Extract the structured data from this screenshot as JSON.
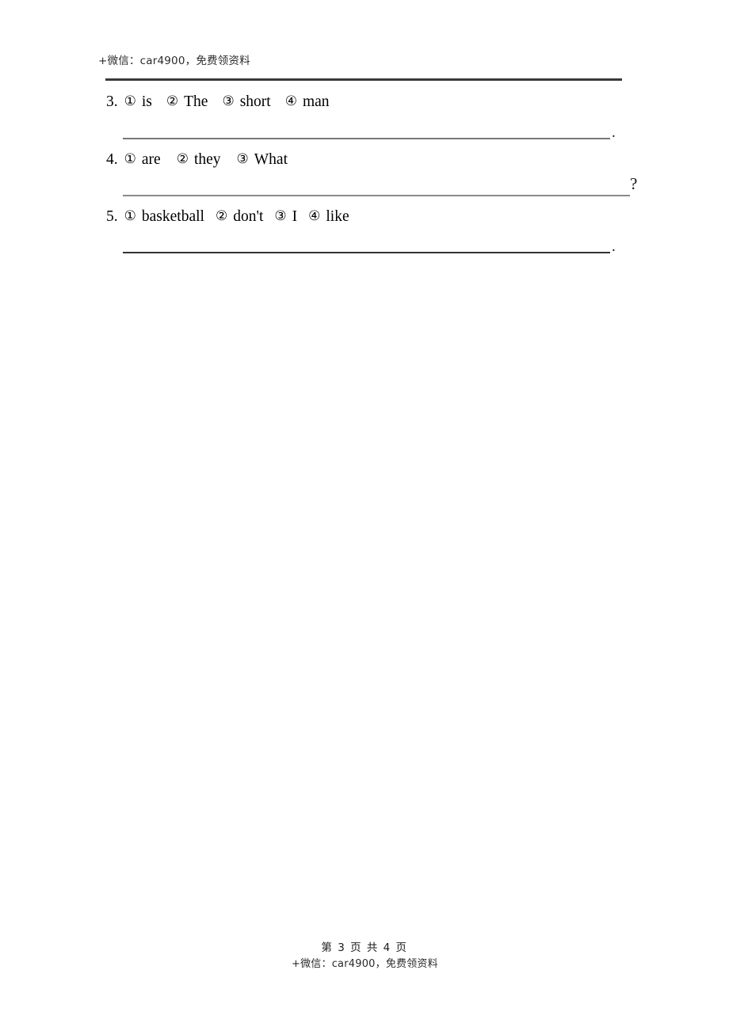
{
  "document": {
    "watermark_top": "+微信：car4900，免费领资料",
    "watermark_bottom": "+微信：car4900，免费领资料",
    "footer_page_label": "第 3 页 共 4 页"
  },
  "questions": [
    {
      "number": "3.",
      "options": [
        {
          "mark": "①",
          "word": "is"
        },
        {
          "mark": "②",
          "word": "The"
        },
        {
          "mark": "③",
          "word": "short"
        },
        {
          "mark": "④",
          "word": "man"
        }
      ],
      "answer_value": "",
      "end_punctuation": "."
    },
    {
      "number": "4.",
      "options": [
        {
          "mark": "①",
          "word": "are"
        },
        {
          "mark": "②",
          "word": "they"
        },
        {
          "mark": "③",
          "word": "What"
        }
      ],
      "answer_value": "",
      "end_punctuation": "?"
    },
    {
      "number": "5.",
      "options": [
        {
          "mark": "①",
          "word": "basketball"
        },
        {
          "mark": "②",
          "word": "don't"
        },
        {
          "mark": "③",
          "word": "I"
        },
        {
          "mark": "④",
          "word": "like"
        }
      ],
      "answer_value": "",
      "end_punctuation": "."
    }
  ]
}
